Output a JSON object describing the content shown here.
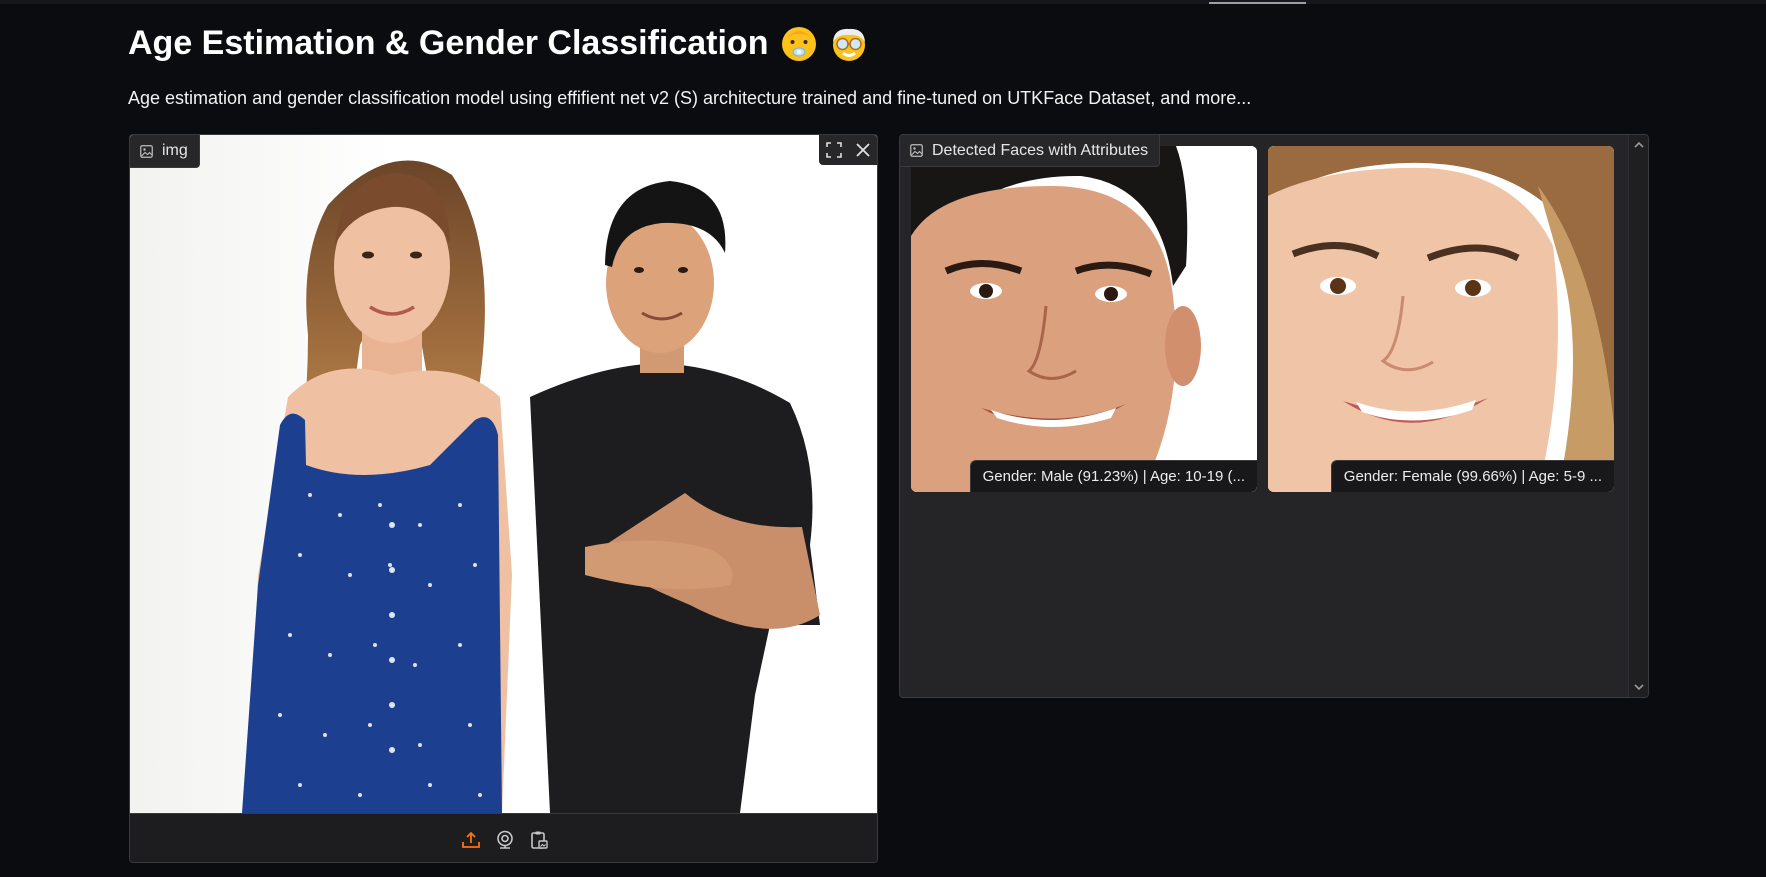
{
  "header": {
    "title": "Age Estimation & Gender Classification",
    "title_emojis": [
      "baby-emoji",
      "older-adult-emoji"
    ],
    "description": "Age estimation and gender classification model using effifient net v2 (S) architecture trained and fine-tuned on UTKFace Dataset, and more..."
  },
  "input_image": {
    "label": "img",
    "label_icon": "image-icon",
    "controls": [
      {
        "name": "fullscreen",
        "icon": "fullscreen-icon"
      },
      {
        "name": "clear",
        "icon": "close-icon"
      }
    ],
    "sources": [
      {
        "name": "upload",
        "icon": "upload-icon",
        "active": true
      },
      {
        "name": "webcam",
        "icon": "webcam-icon",
        "active": false
      },
      {
        "name": "clipboard",
        "icon": "clipboard-icon",
        "active": false
      }
    ]
  },
  "output_gallery": {
    "label": "Detected Faces with Attributes",
    "label_icon": "image-icon",
    "items": [
      {
        "caption": "Gender: Male (91.23%) | Age: 10-19 (..."
      },
      {
        "caption": "Gender: Female (99.66%) | Age: 5-9 ..."
      }
    ]
  },
  "colors": {
    "background": "#0b0c0f",
    "panel": "#1b1b1e",
    "panel_output": "#252528",
    "border": "#3a3a3d",
    "accent_orange": "#f97316",
    "text": "#ffffff"
  }
}
